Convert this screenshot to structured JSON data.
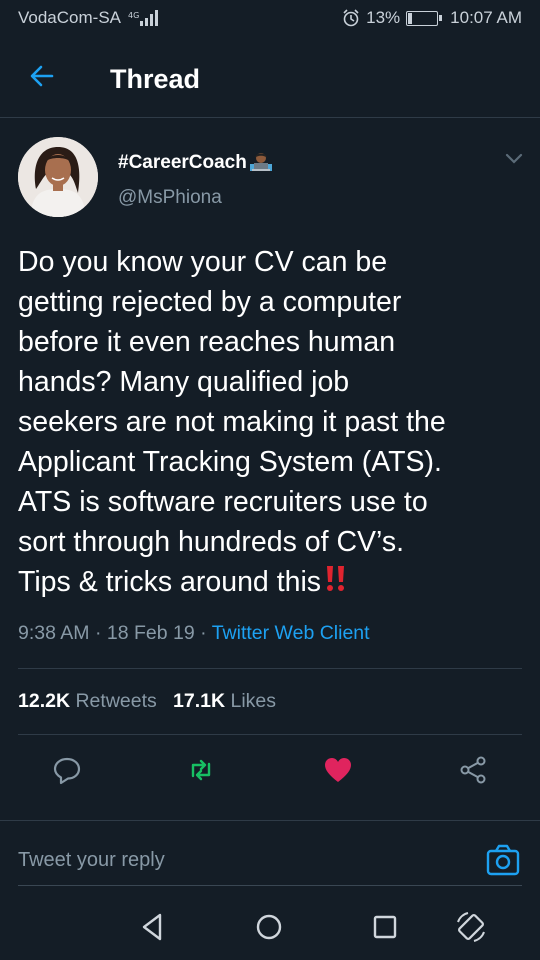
{
  "status_bar": {
    "carrier": "VodaCom-SA",
    "battery": "13%",
    "time": "10:07 AM"
  },
  "header": {
    "title": "Thread"
  },
  "tweet": {
    "display_name": "#CareerCoach",
    "handle": "@MsPhiona",
    "text": "Do you know your CV can be\ngetting rejected by a computer\nbefore it even reaches human\nhands? Many qualified job\nseekers are not making it past the\nApplicant Tracking System (ATS).\nATS is software recruiters use to\nsort through hundreds of CV’s.\nTips & tricks around this",
    "time": "9:38 AM",
    "date": "18 Feb 19",
    "client": "Twitter Web Client",
    "retweets_count": "12.2K",
    "retweets_label": "Retweets",
    "likes_count": "17.1K",
    "likes_label": "Likes"
  },
  "reply": {
    "placeholder": "Tweet your reply"
  },
  "colors": {
    "background": "#141d26",
    "accent": "#1da1f2",
    "retweet": "#17bf63",
    "like": "#e0245e",
    "muted": "#8899a6"
  },
  "icons": [
    "back-arrow-icon",
    "chevron-down-icon",
    "reply-icon",
    "retweet-icon",
    "heart-icon",
    "share-icon",
    "camera-icon",
    "nav-back-icon",
    "nav-home-icon",
    "nav-recents-icon",
    "rotate-icon"
  ]
}
